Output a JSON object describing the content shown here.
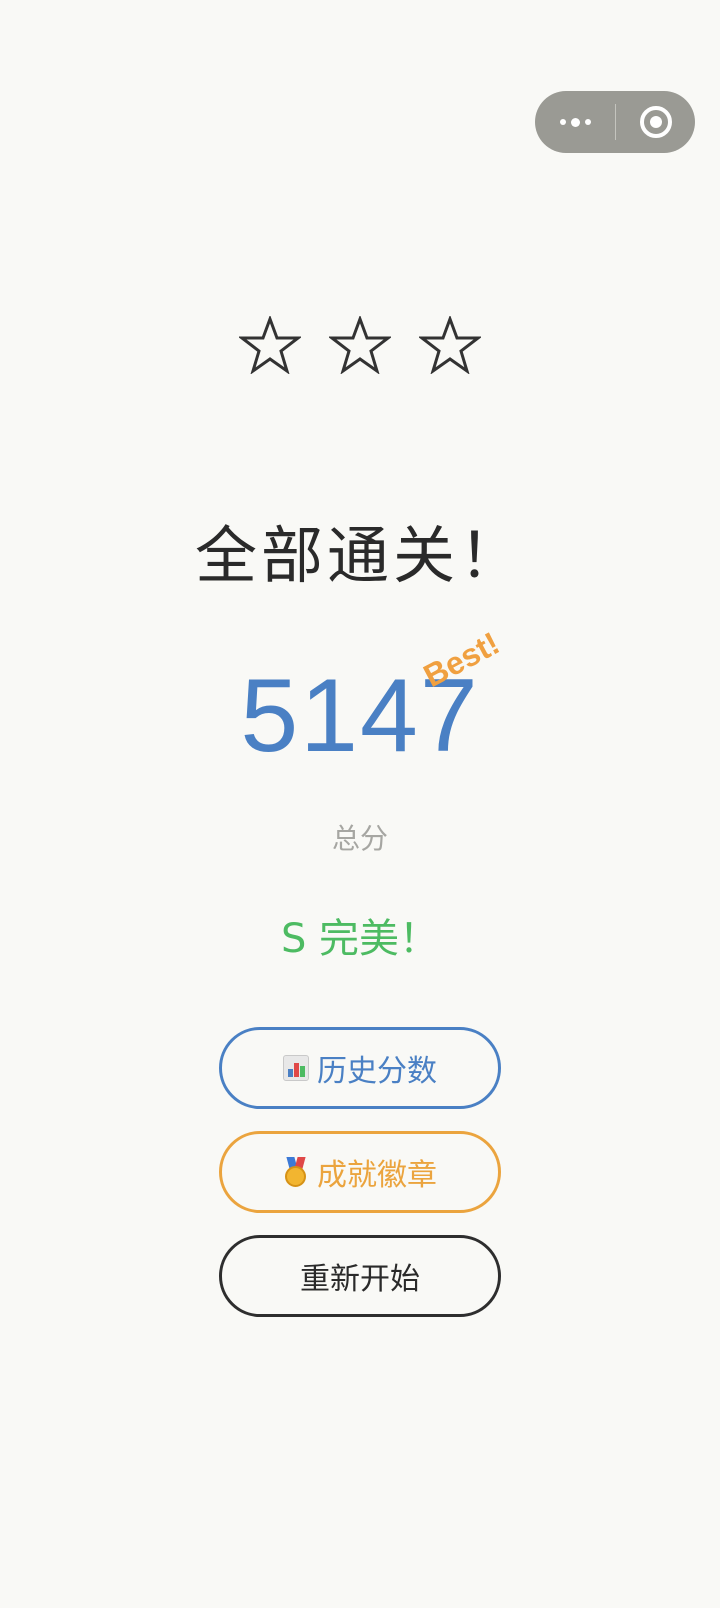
{
  "capsule": {
    "menu_icon": "more-dots-icon",
    "close_icon": "target-circle-icon"
  },
  "stars": {
    "total": 3,
    "earned": 0,
    "icon": "star-outline-icon"
  },
  "result": {
    "title": "全部通关！",
    "score": "5147",
    "best_tag": "Best!",
    "score_label": "总分",
    "rating": "S 完美！"
  },
  "buttons": {
    "history": {
      "icon": "bar-chart-icon",
      "label": "历史分数"
    },
    "badges": {
      "icon": "medal-icon",
      "label": "成就徽章"
    },
    "restart": {
      "label": "重新开始"
    }
  },
  "colors": {
    "background": "#f9f9f6",
    "score": "#4a80c4",
    "best": "#f0a040",
    "rating": "#4dbb62",
    "history_button": "#4a80c4",
    "badges_button": "#eba43e",
    "restart_button": "#2e2e2e"
  }
}
